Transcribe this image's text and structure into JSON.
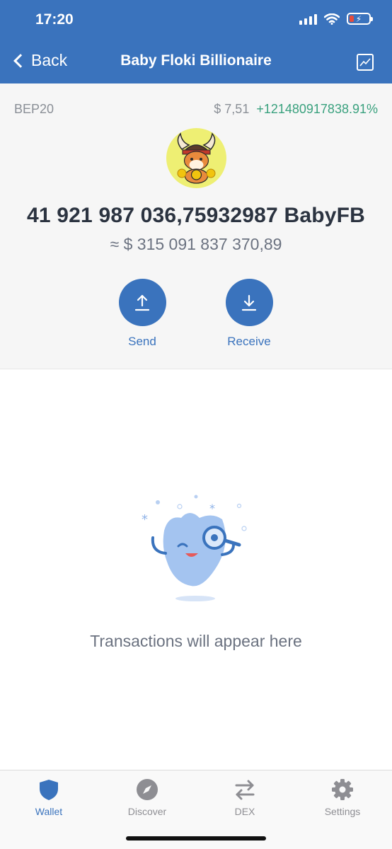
{
  "status_bar": {
    "time": "17:20"
  },
  "nav": {
    "back_label": "Back",
    "title": "Baby Floki Billionaire",
    "chart_icon": "chart-icon"
  },
  "token": {
    "network": "BEP20",
    "price": "$ 7,51",
    "change": "+121480917838.91%",
    "balance": "41 921 987 036,75932987 BabyFB",
    "fiat_value": "≈ $ 315 091 837 370,89"
  },
  "actions": {
    "send_label": "Send",
    "receive_label": "Receive"
  },
  "empty_state": {
    "text": "Transactions will appear here"
  },
  "tabs": [
    {
      "label": "Wallet",
      "icon": "shield-icon",
      "active": true
    },
    {
      "label": "Discover",
      "icon": "compass-icon",
      "active": false
    },
    {
      "label": "DEX",
      "icon": "swap-arrows-icon",
      "active": false
    },
    {
      "label": "Settings",
      "icon": "gear-icon",
      "active": false
    }
  ],
  "colors": {
    "brand": "#3a73bd",
    "positive": "#3aa17e",
    "battery_low": "#e74c3c"
  }
}
